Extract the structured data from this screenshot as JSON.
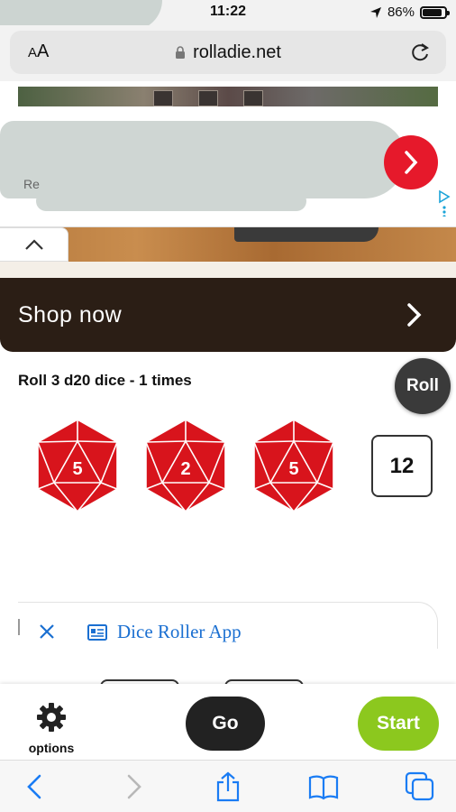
{
  "status_bar": {
    "time": "11:22",
    "battery": "86%",
    "battery_level": 0.86
  },
  "browser": {
    "text_size_label_small": "A",
    "text_size_label_large": "A",
    "url": "rolladie.net"
  },
  "ad": {
    "cta_label": "Shop now",
    "ref_text": "Re"
  },
  "roller": {
    "title": "Roll 3 d20 dice - 1 times",
    "roll_label": "Roll",
    "dice": [
      {
        "value": "5"
      },
      {
        "value": "2"
      },
      {
        "value": "5"
      }
    ],
    "total": "12",
    "die_color": "#d8141c"
  },
  "app_banner": {
    "label": "Dice Roller App"
  },
  "toolbar": {
    "options_label": "options",
    "go_label": "Go",
    "start_label": "Start",
    "start_color": "#8cc81e"
  },
  "icons": [
    "location-arrow-icon",
    "battery-icon",
    "lock-icon",
    "reload-icon",
    "chevron-right-icon",
    "chevron-up-icon",
    "ad-choices-icon",
    "close-icon",
    "app-card-icon",
    "gear-icon",
    "back-icon",
    "forward-icon",
    "share-icon",
    "bookmarks-icon",
    "tabs-icon"
  ]
}
